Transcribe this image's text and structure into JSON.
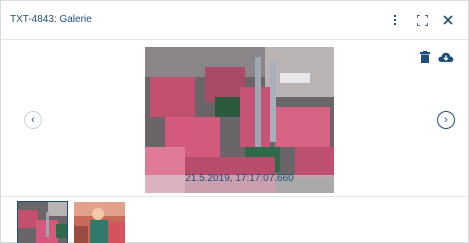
{
  "dialog": {
    "title": "TXT-4843: Galerie",
    "header_icons": [
      "more-vertical-icon",
      "fullscreen-icon",
      "close-icon"
    ]
  },
  "viewer": {
    "timestamp": "21.5.2019, 17:17:07.660",
    "prev_icon": "chevron-left-icon",
    "next_icon": "chevron-right-icon",
    "actions": [
      "trash-icon",
      "cloud-download-icon"
    ]
  },
  "thumbnails": [
    {
      "name": "thumbnail-1",
      "selected": true
    },
    {
      "name": "thumbnail-2",
      "selected": false
    }
  ],
  "colors": {
    "accent": "#1f4e79",
    "border": "#d6dbe0"
  }
}
